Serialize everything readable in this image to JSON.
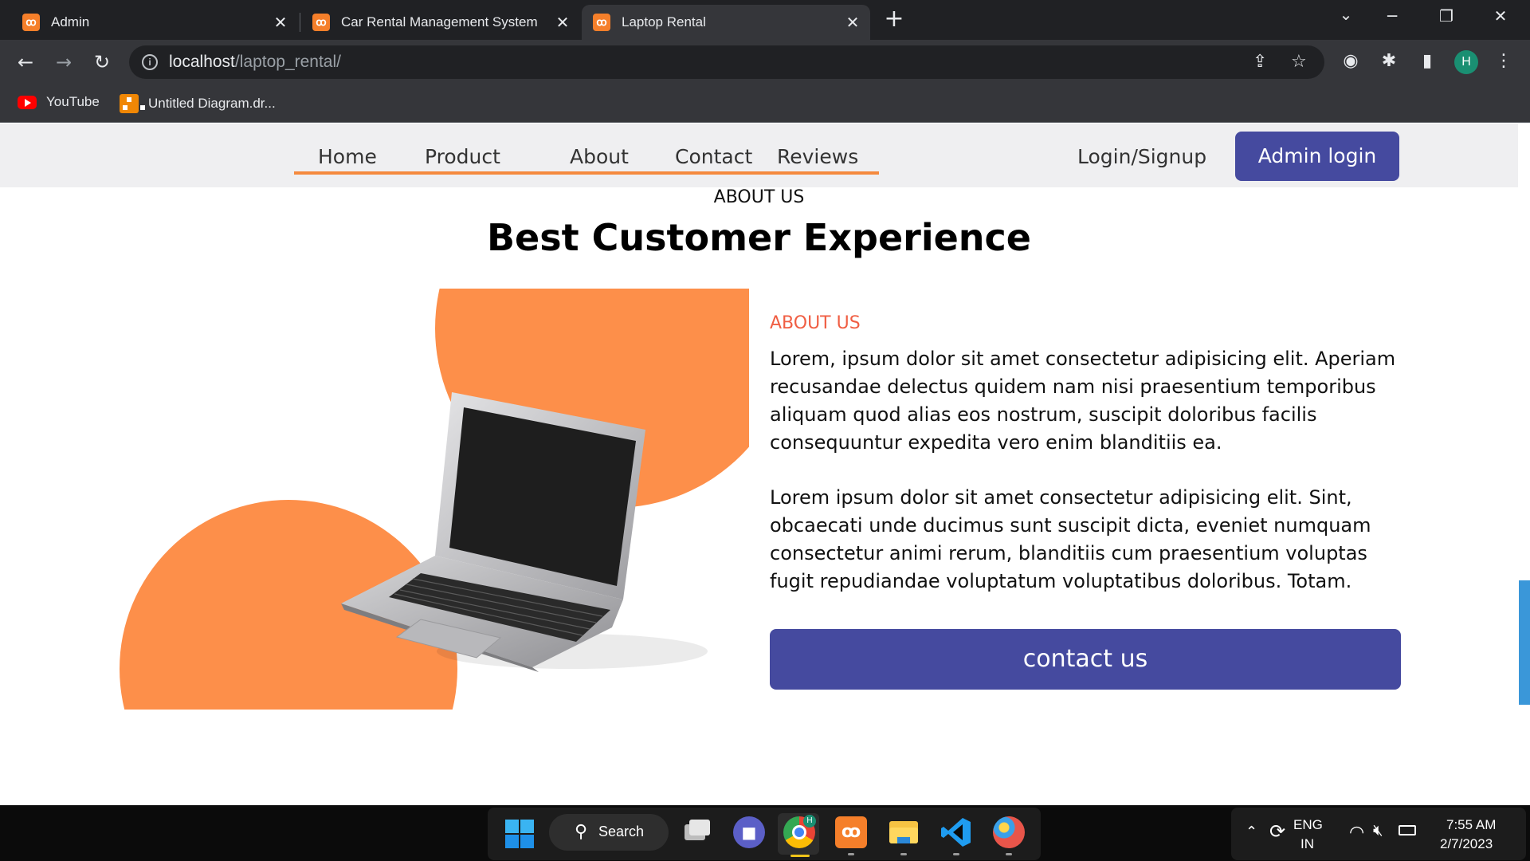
{
  "browser": {
    "tabs": [
      {
        "title": "Admin",
        "active": false
      },
      {
        "title": "Car Rental Management System",
        "active": false
      },
      {
        "title": "Laptop Rental",
        "active": true
      }
    ],
    "url_host": "localhost",
    "url_path": "/laptop_rental/",
    "profile_initial": "H",
    "bookmarks": [
      {
        "label": "YouTube",
        "icon": "youtube-icon"
      },
      {
        "label": "Untitled Diagram.dr...",
        "icon": "drawio-icon"
      }
    ]
  },
  "site": {
    "nav": {
      "links": [
        "Home",
        "Product",
        "About",
        "Contact",
        "Reviews"
      ],
      "login": "Login/Signup",
      "admin_button": "Admin login"
    },
    "about_heading": "ABOUT US",
    "title": "Best Customer Experience",
    "about_label": "ABOUT US",
    "paragraphs": [
      "Lorem, ipsum dolor sit amet consectetur adipisicing elit. Aperiam recusandae delectus quidem nam nisi praesentium temporibus aliquam quod alias eos nostrum, suscipit doloribus facilis consequuntur expedita vero enim blanditiis ea.",
      "Lorem ipsum dolor sit amet consectetur adipisicing elit. Sint, obcaecati unde ducimus sunt suscipit dicta, eveniet numquam consectetur animi rerum, blanditiis cum praesentium voluptas fugit repudiandae voluptatum voluptatibus doloribus. Totam."
    ],
    "contact_button": "contact us",
    "colors": {
      "accent": "#fd8f4a",
      "button": "#454a9f",
      "about_label": "#f05e43"
    }
  },
  "taskbar": {
    "search_label": "Search",
    "lang_line1": "ENG",
    "lang_line2": "IN",
    "time": "7:55 AM",
    "date": "2/7/2023",
    "apps": [
      "start-icon",
      "search-icon",
      "task-view-icon",
      "chat-icon",
      "chrome-icon",
      "xampp-icon",
      "file-explorer-icon",
      "vscode-icon",
      "paint-icon"
    ]
  }
}
